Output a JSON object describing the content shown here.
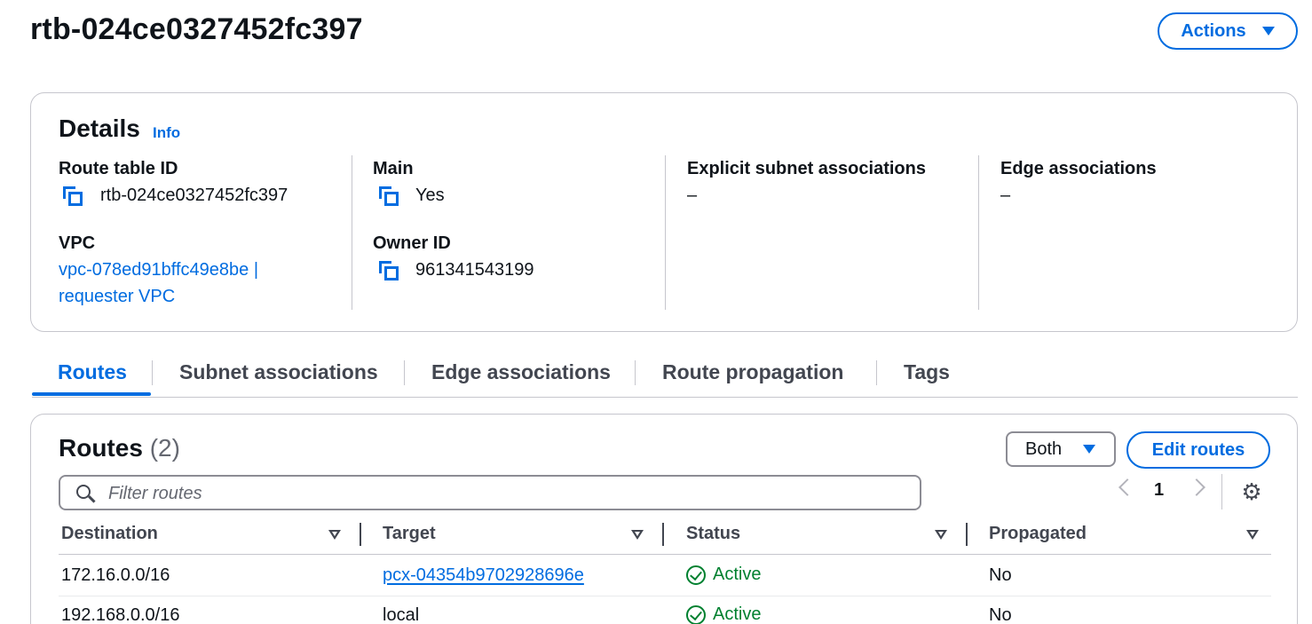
{
  "page": {
    "title": "rtb-024ce0327452fc397",
    "actions_label": "Actions"
  },
  "details": {
    "title": "Details",
    "info_label": "Info",
    "route_table_id": {
      "label": "Route table ID",
      "value": "rtb-024ce0327452fc397"
    },
    "main": {
      "label": "Main",
      "value": "Yes"
    },
    "explicit_subnet": {
      "label": "Explicit subnet associations",
      "value": "–"
    },
    "edge": {
      "label": "Edge associations",
      "value": "–"
    },
    "vpc": {
      "label": "VPC",
      "value_line1": "vpc-078ed91bffc49e8be |",
      "value_line2": "requester VPC"
    },
    "owner_id": {
      "label": "Owner ID",
      "value": "961341543199"
    }
  },
  "tabs": [
    {
      "label": "Routes",
      "active": true
    },
    {
      "label": "Subnet associations",
      "active": false
    },
    {
      "label": "Edge associations",
      "active": false
    },
    {
      "label": "Route propagation",
      "active": false
    },
    {
      "label": "Tags",
      "active": false
    }
  ],
  "routes": {
    "title": "Routes",
    "count": "(2)",
    "filter_select": "Both",
    "edit_label": "Edit routes",
    "search_placeholder": "Filter routes",
    "page_number": "1",
    "columns": [
      "Destination",
      "Target",
      "Status",
      "Propagated"
    ],
    "rows": [
      {
        "destination": "172.16.0.0/16",
        "target": "pcx-04354b9702928696e",
        "target_is_link": true,
        "status": "Active",
        "propagated": "No"
      },
      {
        "destination": "192.168.0.0/16",
        "target": "local",
        "target_is_link": false,
        "status": "Active",
        "propagated": "No"
      }
    ]
  },
  "colors": {
    "accent": "#006ce0",
    "success": "#00802f",
    "border": "#c6c6cd",
    "text": "#0f141a"
  },
  "icons": [
    "copy-icon",
    "search-icon",
    "caret-down-icon",
    "chevron-left-icon",
    "chevron-right-icon",
    "gear-icon",
    "sort-icon",
    "status-success-icon"
  ]
}
